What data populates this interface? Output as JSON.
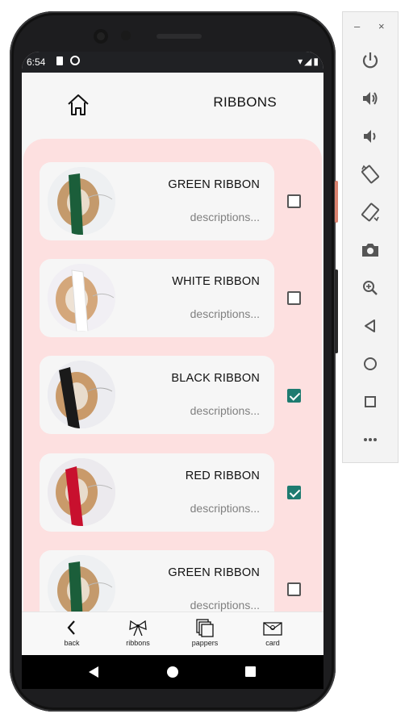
{
  "status_bar": {
    "time": "6:54"
  },
  "app": {
    "title": "RIBBONS"
  },
  "items": [
    {
      "name": "GREEN RIBBON",
      "description": "descriptions...",
      "checked": false,
      "ribbon_color": "#1b5e3a"
    },
    {
      "name": "WHITE RIBBON",
      "description": "descriptions...",
      "checked": false,
      "ribbon_color": "#ffffff"
    },
    {
      "name": "BLACK RIBBON",
      "description": "descriptions...",
      "checked": true,
      "ribbon_color": "#1a1a1a"
    },
    {
      "name": "RED RIBBON",
      "description": "descriptions...",
      "checked": true,
      "ribbon_color": "#c8102e"
    },
    {
      "name": "GREEN RIBBON",
      "description": "descriptions...",
      "checked": false,
      "ribbon_color": "#1b5e3a"
    }
  ],
  "bottom_nav": [
    {
      "label": "back",
      "icon": "chevron-left-icon"
    },
    {
      "label": "ribbons",
      "icon": "bow-icon"
    },
    {
      "label": "pappers",
      "icon": "papers-stack-icon"
    },
    {
      "label": "card",
      "icon": "card-icon"
    }
  ],
  "emulator_toolbar": {
    "minimize": "–",
    "close": "×",
    "buttons": [
      "power-icon",
      "volume-up-icon",
      "volume-down-icon",
      "rotate-left-icon",
      "rotate-right-icon",
      "camera-icon",
      "zoom-icon",
      "back-triangle-icon",
      "home-circle-icon",
      "overview-square-icon",
      "more-icon"
    ]
  },
  "colors": {
    "accent": "#1e7b70",
    "list_background": "#fde0e0",
    "card": "#f6f6f6"
  }
}
